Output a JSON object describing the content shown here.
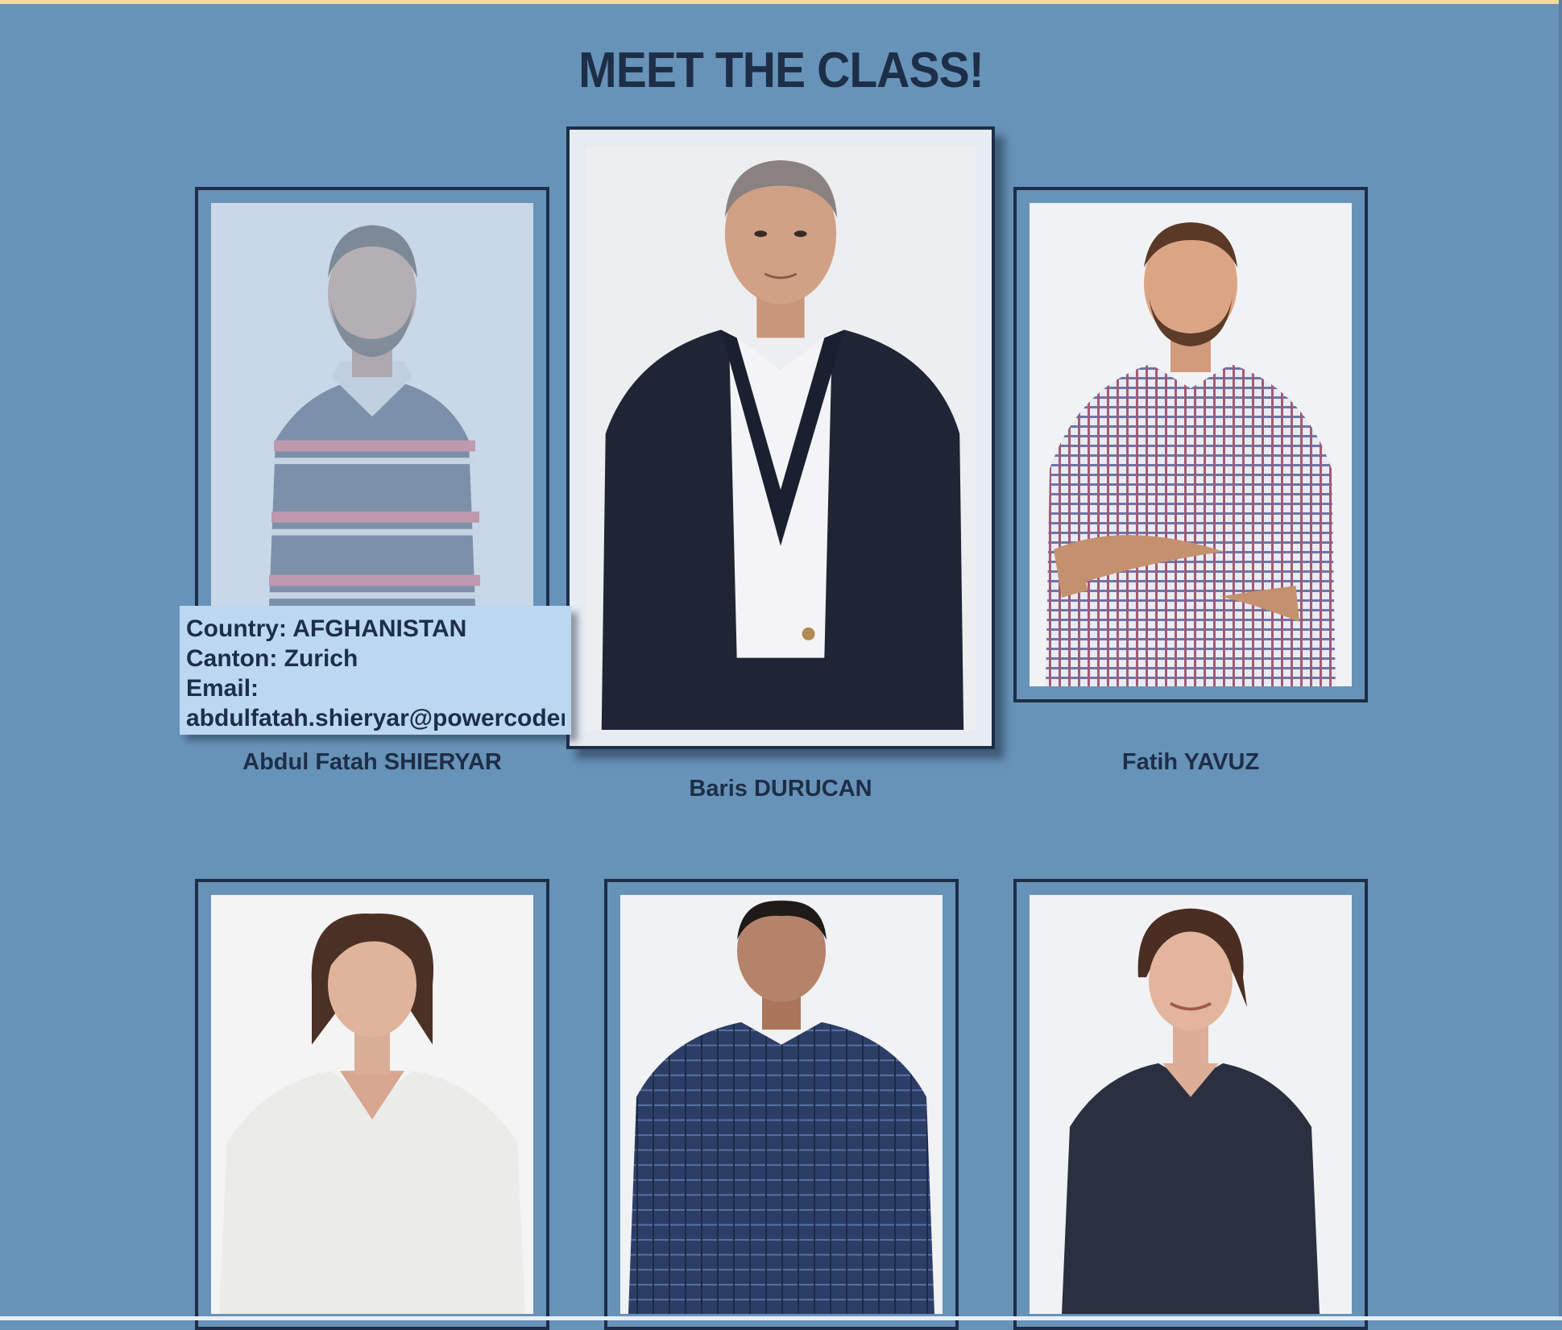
{
  "page": {
    "title": "MEET THE CLASS!",
    "background_color": "#6893b8",
    "accent_color": "#1d2e48"
  },
  "students": [
    {
      "name": "Abdul Fatah SHIERYAR",
      "state": "hovered",
      "tooltip": {
        "country_line": "Country: AFGHANISTAN",
        "canton_line": "Canton: Zurich",
        "email_label": "Email:",
        "email": "abdulfatah.shieryar@powercoders.org"
      }
    },
    {
      "name": "Baris DURUCAN",
      "state": "featured"
    },
    {
      "name": "Fatih YAVUZ",
      "state": "normal"
    },
    {
      "name": "",
      "state": "normal"
    },
    {
      "name": "",
      "state": "normal"
    },
    {
      "name": "",
      "state": "normal"
    }
  ]
}
